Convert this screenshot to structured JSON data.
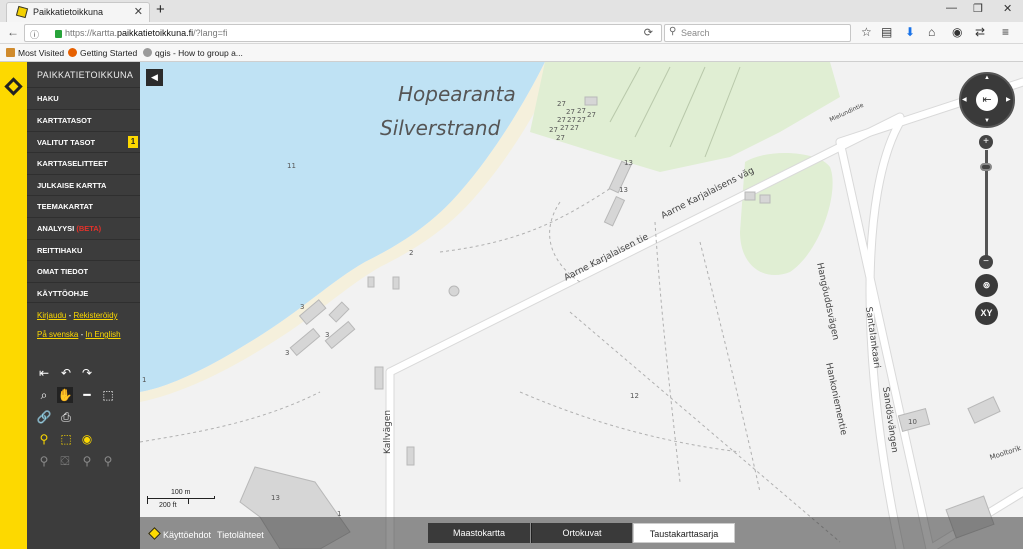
{
  "browser": {
    "tab_title": "Paikkatietoikkuna",
    "url_prefix": "https://kartta.",
    "url_domain": "paikkatietoikkuna.fi",
    "url_suffix": "/?lang=fi",
    "search_placeholder": "Search",
    "bookmarks": [
      "Most Visited",
      "Getting Started",
      "qgis - How to group a..."
    ]
  },
  "sidebar": {
    "brand": "PAIKKATIETOIKKUNA",
    "menu": [
      {
        "label": "HAKU"
      },
      {
        "label": "KARTTATASOT"
      },
      {
        "label": "VALITUT TASOT",
        "badge": "1"
      },
      {
        "label": "KARTTASELITTEET"
      },
      {
        "label": "JULKAISE KARTTA"
      },
      {
        "label": "TEEMAKARTAT"
      },
      {
        "label": "ANALYYSI",
        "suffix": "(BETA)"
      },
      {
        "label": "REITTIHAKU"
      },
      {
        "label": "OMAT TIEDOT"
      },
      {
        "label": "KÄYTTÖOHJE"
      }
    ],
    "login": "Kirjaudu",
    "register": "Rekisteröidy",
    "swedish": "På svenska",
    "english": "In English",
    "dash": "-"
  },
  "map": {
    "place_name_fi": "Hopearanta",
    "place_name_sv": "Silverstrand",
    "road_1": "Aarne Karjalaisen tie",
    "road_2": "Aarne Karjalaisens väg",
    "road_3": "Hangöuddsvägen",
    "road_4": "Hankoniementie",
    "road_5": "Santalankaari",
    "road_6": "Sandösvängen",
    "road_7": "Kallvägen",
    "road_8": "Mooltorik",
    "road_9": "Mielundintie",
    "numbers": [
      "11",
      "2",
      "13",
      "13",
      "3",
      "3",
      "3",
      "12",
      "10",
      "13",
      "1",
      "1",
      "27"
    ],
    "scale_m": "100 m",
    "scale_ft": "200 ft",
    "xy_label": "XY",
    "colors": {
      "water": "#bfe2f4",
      "park": "#e0eed3",
      "land": "#f2f2f2",
      "road": "#ffffff",
      "building": "#d6d6d6"
    }
  },
  "footer": {
    "terms": "Käyttöehdot",
    "sources": "Tietolähteet",
    "basemaps": [
      "Maastokartta",
      "Ortokuvat",
      "Taustakarttasarja"
    ],
    "selected_basemap": "Taustakarttasarja"
  }
}
